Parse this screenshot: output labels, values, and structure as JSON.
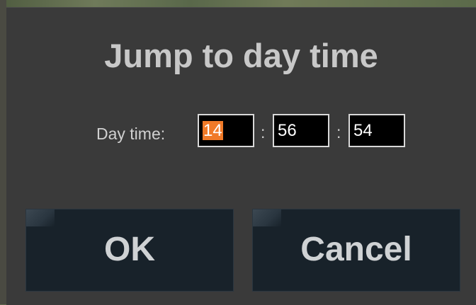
{
  "dialog": {
    "title": "Jump to day time",
    "label": "Day time:",
    "hours": "14",
    "minutes": "56",
    "seconds": "54",
    "separator": ":",
    "ok_label": "OK",
    "cancel_label": "Cancel"
  },
  "colors": {
    "dialog_bg": "#3a3a3a",
    "button_bg": "#18222a",
    "selection": "#f07a28",
    "field_bg": "#000000"
  }
}
